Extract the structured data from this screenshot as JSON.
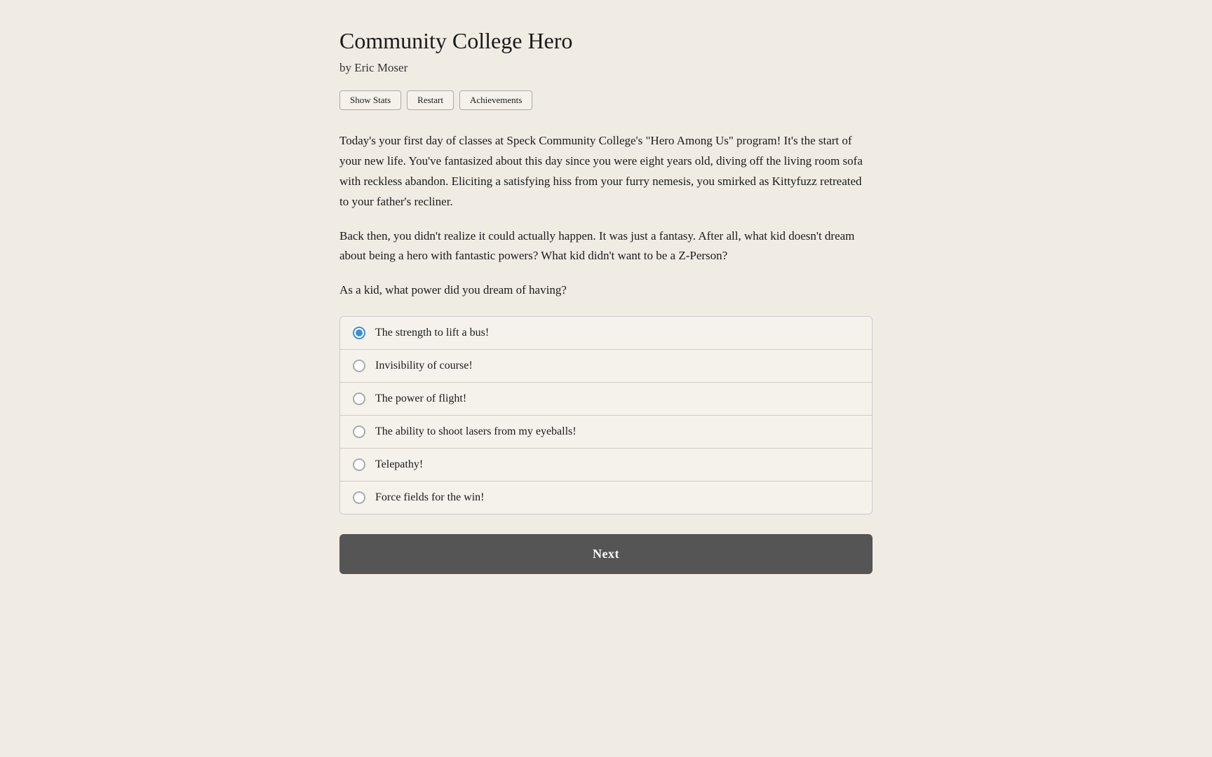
{
  "header": {
    "title": "Community College Hero",
    "author": "by Eric Moser"
  },
  "toolbar": {
    "show_stats_label": "Show Stats",
    "restart_label": "Restart",
    "achievements_label": "Achievements"
  },
  "story": {
    "paragraph1": "Today's your first day of classes at Speck Community College's \"Hero Among Us\" program! It's the start of your new life. You've fantasized about this day since you were eight years old, diving off the living room sofa with reckless abandon. Eliciting a satisfying hiss from your furry nemesis, you smirked as Kittyfuzz retreated to your father's recliner.",
    "paragraph2": "Back then, you didn't realize it could actually happen. It was just a fantasy. After all, what kid doesn't dream about being a hero with fantastic powers? What kid didn't want to be a Z-Person?",
    "question": "As a kid, what power did you dream of having?"
  },
  "choices": [
    {
      "id": "choice1",
      "label": "The strength to lift a bus!",
      "selected": true
    },
    {
      "id": "choice2",
      "label": "Invisibility of course!",
      "selected": false
    },
    {
      "id": "choice3",
      "label": "The power of flight!",
      "selected": false
    },
    {
      "id": "choice4",
      "label": "The ability to shoot lasers from my eyeballs!",
      "selected": false
    },
    {
      "id": "choice5",
      "label": "Telepathy!",
      "selected": false
    },
    {
      "id": "choice6",
      "label": "Force fields for the win!",
      "selected": false
    }
  ],
  "next_button": {
    "label": "Next"
  },
  "colors": {
    "background": "#f0ece4",
    "button_bg": "#555555",
    "radio_selected": "#3a8fd8"
  }
}
